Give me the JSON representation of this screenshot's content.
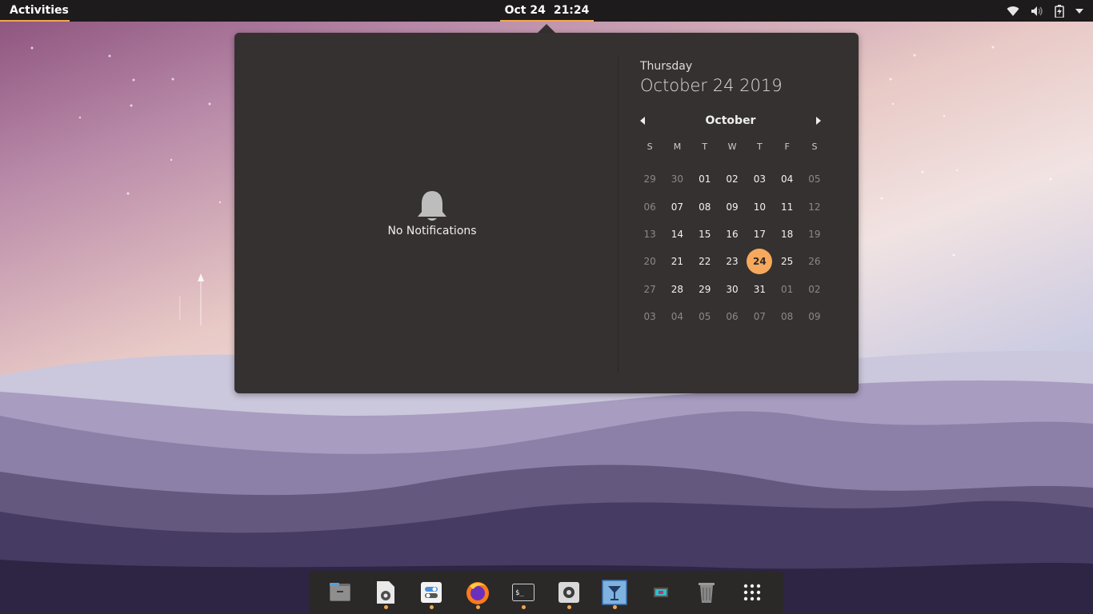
{
  "topbar": {
    "activities_label": "Activities",
    "clock_date": "Oct 24",
    "clock_time": "21:24",
    "tray_icons": [
      "wifi-icon",
      "volume-icon",
      "battery-icon",
      "system-menu-arrow-icon"
    ]
  },
  "notifications": {
    "empty_text": "No Notifications"
  },
  "calendar": {
    "weekday": "Thursday",
    "full_date": "October 24 2019",
    "month": "October",
    "day_headers": [
      "S",
      "M",
      "T",
      "W",
      "T",
      "F",
      "S"
    ],
    "days": [
      {
        "label": "29",
        "dim": true
      },
      {
        "label": "30",
        "dim": true
      },
      {
        "label": "01"
      },
      {
        "label": "02"
      },
      {
        "label": "03"
      },
      {
        "label": "04"
      },
      {
        "label": "05",
        "dim": true
      },
      {
        "label": "06",
        "dim": true
      },
      {
        "label": "07"
      },
      {
        "label": "08"
      },
      {
        "label": "09"
      },
      {
        "label": "10"
      },
      {
        "label": "11"
      },
      {
        "label": "12",
        "dim": true
      },
      {
        "label": "13",
        "dim": true
      },
      {
        "label": "14"
      },
      {
        "label": "15"
      },
      {
        "label": "16"
      },
      {
        "label": "17"
      },
      {
        "label": "18"
      },
      {
        "label": "19",
        "dim": true
      },
      {
        "label": "20",
        "dim": true
      },
      {
        "label": "21"
      },
      {
        "label": "22"
      },
      {
        "label": "23"
      },
      {
        "label": "24",
        "today": true
      },
      {
        "label": "25"
      },
      {
        "label": "26",
        "dim": true
      },
      {
        "label": "27",
        "dim": true
      },
      {
        "label": "28"
      },
      {
        "label": "29"
      },
      {
        "label": "30"
      },
      {
        "label": "31"
      },
      {
        "label": "01",
        "dim": true
      },
      {
        "label": "02",
        "dim": true
      },
      {
        "label": "03",
        "dim": true
      },
      {
        "label": "04",
        "dim": true
      },
      {
        "label": "05",
        "dim": true
      },
      {
        "label": "06",
        "dim": true
      },
      {
        "label": "07",
        "dim": true
      },
      {
        "label": "08",
        "dim": true
      },
      {
        "label": "09",
        "dim": true
      }
    ]
  },
  "dock": {
    "items": [
      {
        "name": "files-app-icon",
        "running": false
      },
      {
        "name": "text-editor-icon",
        "running": true
      },
      {
        "name": "tweaks-app-icon",
        "running": true
      },
      {
        "name": "firefox-icon",
        "running": true
      },
      {
        "name": "terminal-icon",
        "running": true
      },
      {
        "name": "settings-icon",
        "running": true
      },
      {
        "name": "glade-app-icon",
        "running": true
      },
      {
        "name": "screen-recorder-icon",
        "running": false
      },
      {
        "name": "trash-icon",
        "running": false
      },
      {
        "name": "show-applications-icon",
        "running": false
      }
    ]
  },
  "colors": {
    "accent": "#f2a64f",
    "today": "#f6a95c",
    "popover_bg": "#353130",
    "topbar_bg": "#1d1b1b"
  }
}
